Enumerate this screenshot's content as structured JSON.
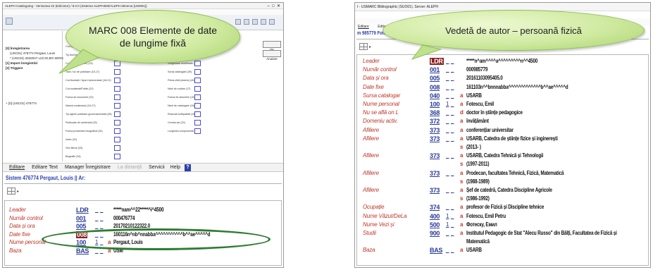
{
  "left": {
    "window_title": "ALEPH Cataloguing - Versiunea 22 (Edit.istor) / 8.0.0 (Sistema ALEPH500/ALEPH Minerva [USM01])",
    "menu": [
      "ALEPH",
      "Utilitare",
      "Catalogare",
      "Servicii"
    ],
    "callout": "MARC 008 Elemente de date de lungime fixă",
    "tree": {
      "items": [
        "[0] Înregistrarea",
        "(USC01) 476774 Pergaut, Louis",
        "* (USC01) 2532047 LUCIO,BO SERG",
        "[1] Import înregistrări",
        "[2] Triggere"
      ],
      "footer": "+ [0] (USC01) 476774"
    },
    "side_buttons": [
      "OK",
      "Anulare"
    ],
    "form_fields_left": [
      {
        "label": "Data înregistrării (00-05)",
        "value": "201014"
      },
      {
        "label": "Cod tipul de înregistrare (06)",
        "value": "a"
      },
      {
        "label": "Tip Anul/date (07-14)",
        "value": ""
      },
      {
        "label": "Cod de statut(Date) (15)",
        "value": ""
      },
      {
        "label": "Țară / loc de publicare (15-17)",
        "value": ""
      },
      {
        "label": "Cod ilustrații / tipuri reprezentare (18-21)",
        "value": ""
      },
      {
        "label": "Cod audiență/Public (22)",
        "value": ""
      },
      {
        "label": "Forma de document (23)",
        "value": ""
      },
      {
        "label": "Natura conținutului (24-27)",
        "value": ""
      },
      {
        "label": "Tip agent/ publicare guvernamentală (28)",
        "value": ""
      },
      {
        "label": "Publicație de conferință (29)",
        "value": ""
      },
      {
        "label": "Forma prezentare biografică (30)",
        "value": ""
      },
      {
        "label": "Index (31)",
        "value": ""
      },
      {
        "label": "Gen literar (33)",
        "value": ""
      },
      {
        "label": "Biografie (34)",
        "value": ""
      }
    ],
    "form_fields_right": [
      {
        "label": "Index de forma (34)",
        "value": "0"
      },
      {
        "label": "Cod de biografie (35)",
        "value": ""
      },
      {
        "label": "Limba (35-37)",
        "value": ""
      },
      {
        "label": "Înregistrare modificată (38)",
        "value": ""
      },
      {
        "label": "Sursa catalogării (39)",
        "value": ""
      },
      {
        "label": "Prima cifră (sistem) (40)",
        "value": ""
      },
      {
        "label": "Nivel de codare (17)",
        "value": ""
      },
      {
        "label": "Forma de descriere (18)",
        "value": ""
      },
      {
        "label": "Nivel de catalogare (19)",
        "value": ""
      },
      {
        "label": "Resursă multipartită (19)",
        "value": ""
      },
      {
        "label": "Cerinta set (20)",
        "value": ""
      },
      {
        "label": "Lungimea componentei (21)",
        "value": ""
      }
    ],
    "tabs": [
      "Editare",
      "Editare Text",
      "Manager Înregistrare",
      "La distanţă",
      "Servicii",
      "Help"
    ],
    "record_title": "Sistem 476774 Pergaut, Louis || Ar:",
    "record": [
      {
        "label": "Leader",
        "tag": "LDR",
        "ind": "",
        "sub": "",
        "value": "*****nam^^22*****^i^4500"
      },
      {
        "label": "Număr control",
        "tag": "001",
        "ind": "",
        "sub": "",
        "value": "000476774"
      },
      {
        "label": "Data și ora",
        "tag": "005",
        "ind": "",
        "sub": "",
        "value": "20170210122322.0"
      },
      {
        "label": "Date fixe",
        "tag": "008",
        "ind": "",
        "sub": "",
        "value": "160116n^nb^nnabba^^^^^^^^^^^b^^ae^^^^^d",
        "selected": true
      },
      {
        "label": "Nume personal",
        "tag": "100",
        "ind": "1",
        "sub": "a",
        "value": "Pergaut, Louis"
      },
      {
        "label": "Baza",
        "tag": "BAS",
        "ind": "",
        "sub": "a",
        "value": "USM"
      }
    ]
  },
  "right": {
    "window_title": "I - USMARC Bibliographic (SUO01). Server: ALEPH",
    "menu": [
      "Editare",
      "Editare T"
    ],
    "record_title": "m 985779 Fotes",
    "callout": "Vedetă de autor – persoană fizică",
    "record": [
      {
        "label": "Leader",
        "tag": "LDR",
        "ind": "",
        "sub": "",
        "value": "*****n^am^^^^a^^^^^^^^^n^^4500",
        "selected": true
      },
      {
        "label": "Număr control",
        "tag": "001",
        "ind": "",
        "sub": "",
        "value": "000985779"
      },
      {
        "label": "Data și ora",
        "tag": "005",
        "ind": "",
        "sub": "",
        "value": "20161103095405.0"
      },
      {
        "label": "Date fixe",
        "tag": "008",
        "ind": "",
        "sub": "",
        "value": "161103n^^bnnnabba^^^^^^^^^^^^^b^^ae^^^^^d"
      },
      {
        "label": "Sursa catalogar",
        "tag": "040",
        "ind": "",
        "sub": "a",
        "value": "USARB"
      },
      {
        "label": "Nume personal",
        "tag": "100",
        "ind": "1",
        "sub": "a",
        "value": "Fotescu, Emil"
      },
      {
        "label": "Nu se află on L",
        "tag": "368",
        "ind": "",
        "sub": "d",
        "value": "doctor în științe pedagogice"
      },
      {
        "label": "Domeniu activ.",
        "tag": "372",
        "ind": "",
        "sub": "a",
        "value": "învățământ"
      },
      {
        "label": "Afiliere",
        "tag": "373",
        "ind": "",
        "sub": "a",
        "value": "conferențiar universitar"
      },
      {
        "label": "Afiliere",
        "tag": "373",
        "ind": "",
        "sub": "a",
        "value": "USARB, Catedra de științe fizice și inginerești"
      },
      {
        "label": "",
        "tag": "",
        "ind": "",
        "sub": "s",
        "value": "(2013- )"
      },
      {
        "label": "Afiliere",
        "tag": "373",
        "ind": "",
        "sub": "a",
        "value": "USARB, Catedra Tehnică și Tehnologii"
      },
      {
        "label": "",
        "tag": "",
        "ind": "",
        "sub": "s",
        "value": "(1997-2011)"
      },
      {
        "label": "Afiliere",
        "tag": "373",
        "ind": "",
        "sub": "a",
        "value": "Prodecan, facultatea Tehnică, Fizică, Matematică"
      },
      {
        "label": "",
        "tag": "",
        "ind": "",
        "sub": "s",
        "value": "(1988-1989)"
      },
      {
        "label": "Afiliere",
        "tag": "373",
        "ind": "",
        "sub": "a",
        "value": "Șef de catedră, Catedra Discipline Agricole"
      },
      {
        "label": "",
        "tag": "",
        "ind": "",
        "sub": "s",
        "value": "(1986-1992)"
      },
      {
        "label": "Ocupație",
        "tag": "374",
        "ind": "",
        "sub": "a",
        "value": "profesor de Fizică și Discipline tehnice"
      },
      {
        "label": "Nume Văzut/DeLa",
        "tag": "400",
        "ind": "1",
        "sub": "a",
        "value": "Fotescu, Emil Petru"
      },
      {
        "label": "Nume Vezi și",
        "tag": "500",
        "ind": "1",
        "sub": "a",
        "value": "Фотеску, Емил"
      },
      {
        "label": "Studii",
        "tag": "900",
        "ind": "",
        "sub": "a",
        "value": "Institutul Pedagogic de Stat \"Alecu Russo\" din Bălți, Facultatea de Fizică și"
      },
      {
        "label": "",
        "tag": "",
        "ind": "",
        "sub": "",
        "value": "Matematică"
      },
      {
        "label": "Baza",
        "tag": "BAS",
        "ind": "",
        "sub": "a",
        "value": "USARB"
      }
    ]
  },
  "colors": {
    "callout_fill": "#cfeaa0",
    "oval_highlight": "#2e7d32",
    "label_red": "#c0392b",
    "tag_blue": "#2a3b9a",
    "selected_tag": "#8b1f1f"
  }
}
